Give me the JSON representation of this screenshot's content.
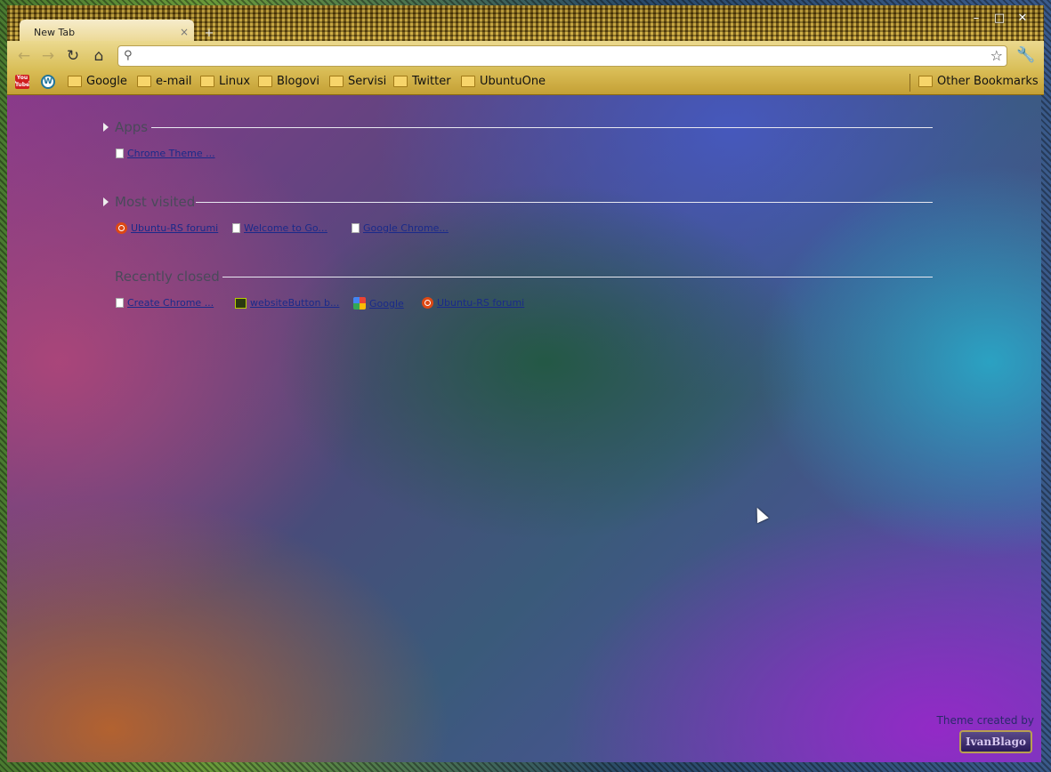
{
  "window": {
    "tab_title": "New Tab",
    "tab_close": "×",
    "new_tab": "+",
    "minimize": "–",
    "maximize": "□",
    "close": "✕"
  },
  "toolbar": {
    "back": "←",
    "forward": "→",
    "reload": "↻",
    "home": "⌂",
    "omnibox_value": "",
    "omnibox_placeholder": "",
    "star": "☆",
    "wrench": "🔧"
  },
  "bookmarks": {
    "youtube_top": "You",
    "youtube_bottom": "Tube",
    "wordpress": "W",
    "items": [
      "Google",
      "e-mail",
      "Linux",
      "Blogovi",
      "Servisi",
      "Twitter",
      "UbuntuOne"
    ],
    "other": "Other Bookmarks"
  },
  "sections": {
    "apps": {
      "title": "Apps",
      "items": [
        "Chrome Theme ..."
      ]
    },
    "most_visited": {
      "title": "Most visited",
      "items": [
        "Ubuntu-RS forumi",
        "Welcome to Go...",
        "Google Chrome..."
      ]
    },
    "recently_closed": {
      "title": "Recently closed",
      "items": [
        "Create Chrome ...",
        "websiteButton b...",
        "Google",
        "Ubuntu-RS forumi"
      ]
    }
  },
  "footer": {
    "credit": "Theme created by",
    "logo": "IvanBlago"
  }
}
